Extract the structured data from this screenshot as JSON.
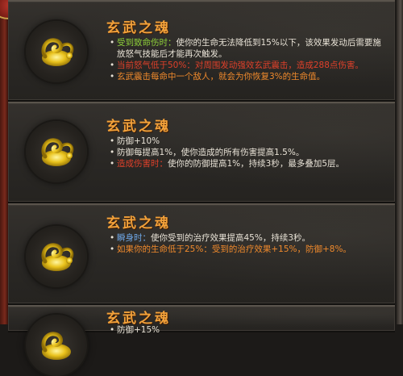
{
  "colors": {
    "title": "#f2a13a",
    "highlight_green": "#8fd13a",
    "highlight_red": "#e0402a",
    "highlight_blue": "#6fa8e8",
    "text_orange": "#f08a2c",
    "text_white": "#e8e2d6"
  },
  "cards": [
    {
      "icon": "golden-turtle-snake-icon",
      "title": "玄武之魂",
      "effects": [
        {
          "label": "受到致命伤时：",
          "text": "使你的生命无法降低到15%以下，该效果发动后需要施放怒气技能后才能再次触发。",
          "label_color": "green",
          "text_color": "white"
        },
        {
          "label": "当前怒气低于50%：",
          "text": "对周围发动强效玄武震击，造成288点伤害。",
          "label_color": "red",
          "text_color": "red"
        },
        {
          "label": "",
          "text": "玄武震击每命中一个敌人，就会为你恢复3%的生命值。",
          "label_color": "orange",
          "text_color": "orange"
        }
      ]
    },
    {
      "icon": "golden-turtle-snake-icon",
      "title": "玄武之魂",
      "effects": [
        {
          "label": "",
          "text": "防御+10%",
          "label_color": "white",
          "text_color": "white"
        },
        {
          "label": "",
          "text": "防御每提高1%，使你造成的所有伤害提高1.5%。",
          "label_color": "white",
          "text_color": "white"
        },
        {
          "label": "造成伤害时：",
          "text": "使你的防御提高1%，持续3秒，最多叠加5层。",
          "label_color": "red",
          "text_color": "white"
        }
      ]
    },
    {
      "icon": "golden-turtle-snake-icon",
      "title": "玄武之魂",
      "effects": [
        {
          "label": "瞬身时：",
          "text": "使你受到的治疗效果提高45%，持续3秒。",
          "label_color": "blue",
          "text_color": "white"
        },
        {
          "label": "",
          "text": "如果你的生命低于25%：受到的治疗效果+15%，防御+8%。",
          "label_color": "orange",
          "text_color": "orange"
        }
      ]
    },
    {
      "icon": "golden-turtle-snake-icon",
      "title": "玄武之魂",
      "effects": [
        {
          "label": "",
          "text": "防御+15%",
          "label_color": "white",
          "text_color": "white"
        }
      ]
    }
  ]
}
